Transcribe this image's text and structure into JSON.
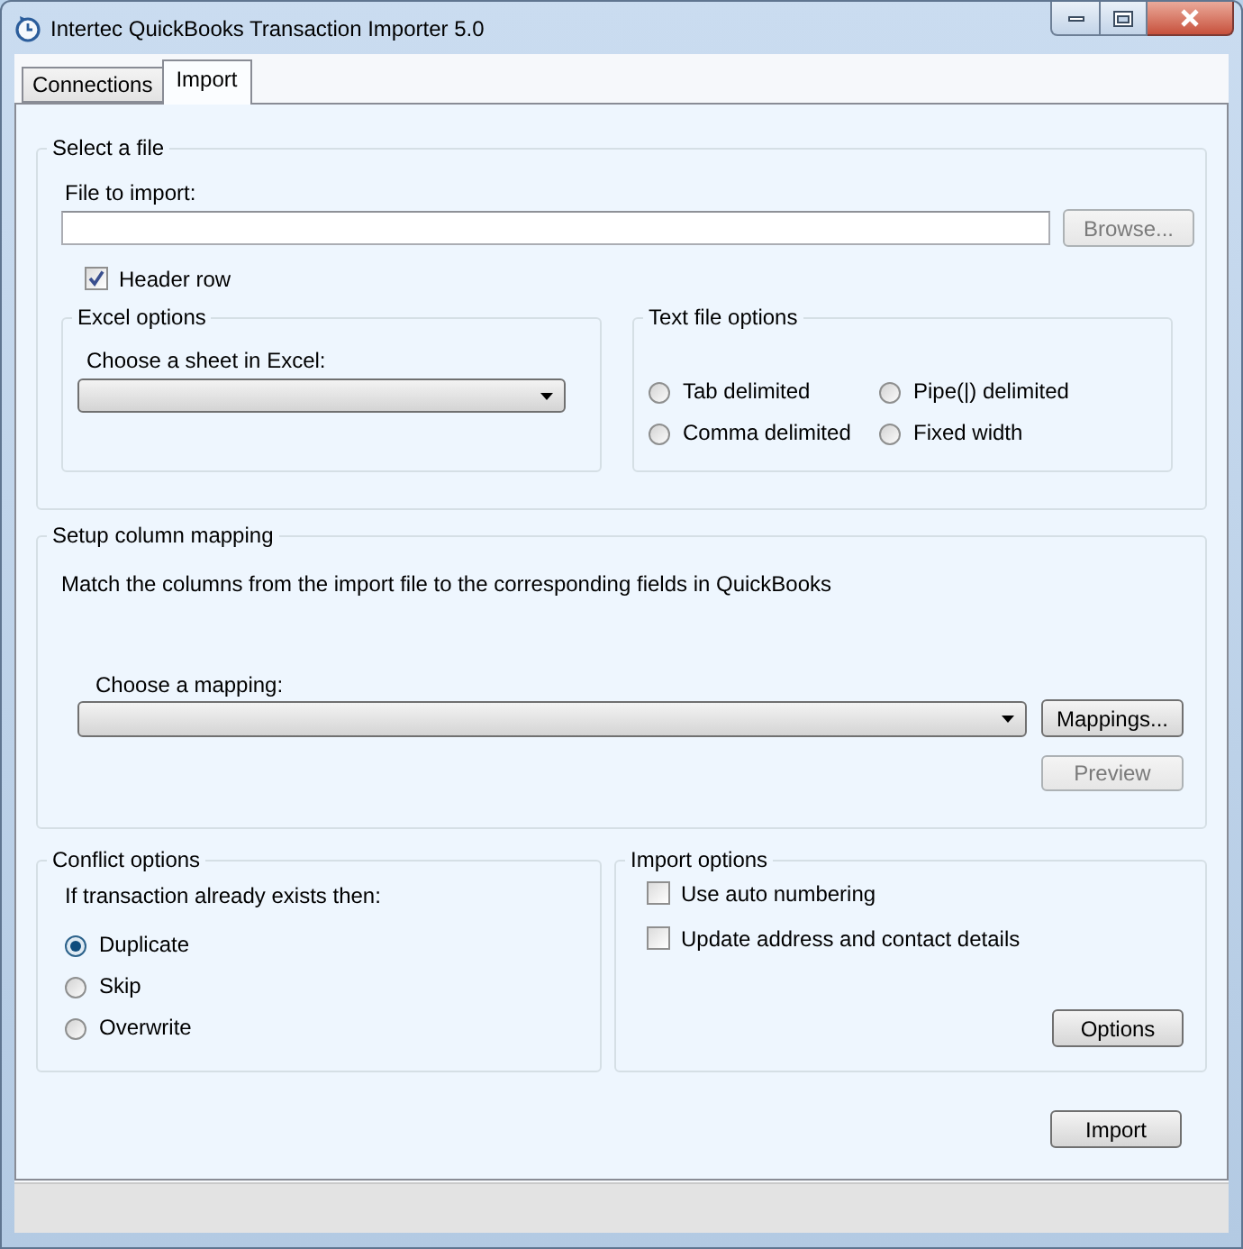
{
  "window": {
    "title": "Intertec QuickBooks Transaction Importer 5.0"
  },
  "tabs": [
    {
      "label": "Connections",
      "selected": false
    },
    {
      "label": "Import",
      "selected": true
    }
  ],
  "select_file": {
    "legend": "Select a file",
    "file_label": "File to import:",
    "browse_button": {
      "label": "Browse...",
      "disabled": true
    },
    "header_row": {
      "label": "Header row",
      "checked": true
    },
    "excel_options": {
      "legend": "Excel options",
      "sheet_label": "Choose a sheet in Excel:"
    },
    "text_file_options": {
      "legend": "Text file options",
      "formats": [
        {
          "label": "Tab delimited",
          "selected": false
        },
        {
          "label": "Pipe(|) delimited",
          "selected": false
        },
        {
          "label": "Comma delimited",
          "selected": false
        },
        {
          "label": "Fixed width",
          "selected": false
        }
      ]
    }
  },
  "column_mapping": {
    "legend": "Setup column mapping",
    "description": "Match the columns from the import file to the corresponding fields in QuickBooks",
    "mapping_label": "Choose a mapping:",
    "mappings_button": {
      "label": "Mappings...",
      "disabled": false
    },
    "preview_button": {
      "label": "Preview",
      "disabled": true
    }
  },
  "conflict_options": {
    "legend": "Conflict options",
    "prompt": "If transaction already exists then:",
    "choices": [
      {
        "label": "Duplicate",
        "selected": true
      },
      {
        "label": "Skip",
        "selected": false
      },
      {
        "label": "Overwrite",
        "selected": false
      }
    ]
  },
  "import_options": {
    "legend": "Import options",
    "checkboxes": [
      {
        "label": "Use auto numbering",
        "checked": false
      },
      {
        "label": "Update address and contact details",
        "checked": false
      }
    ],
    "options_button": {
      "label": "Options",
      "disabled": false
    }
  },
  "import_button": {
    "label": "Import",
    "disabled": false
  }
}
